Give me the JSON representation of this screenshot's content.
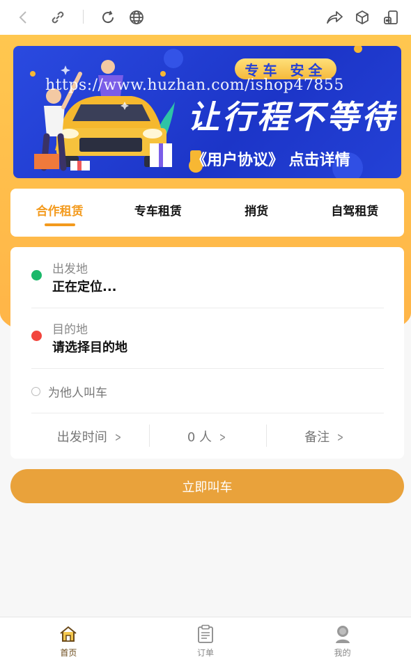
{
  "banner": {
    "watermark": "https://www.huzhan.com/ishop47855",
    "tag": "专车 安全",
    "title": "让行程不等待",
    "subtitle": "《用户协议》 点击详情"
  },
  "tabs": [
    {
      "label": "合作租赁",
      "active": true
    },
    {
      "label": "专车租赁",
      "active": false
    },
    {
      "label": "捎货",
      "active": false
    },
    {
      "label": "自驾租赁",
      "active": false
    }
  ],
  "form": {
    "origin_label": "出发地",
    "origin_value": "正在定位...",
    "destination_label": "目的地",
    "destination_value": "请选择目的地",
    "for_other_label": "为他人叫车",
    "time_label": "出发时间",
    "people_label": "0 人",
    "note_label": "备注"
  },
  "call_button": "立即叫车",
  "nav": [
    {
      "label": "首页",
      "icon": "home-icon",
      "active": true
    },
    {
      "label": "订单",
      "icon": "clipboard-icon",
      "active": false
    },
    {
      "label": "我的",
      "icon": "user-icon",
      "active": false
    }
  ],
  "colors": {
    "accent": "#f39a1d",
    "button": "#e9a23b",
    "origin_dot": "#1bb86a",
    "destination_dot": "#f2453d",
    "banner_blue": "#2441d6"
  }
}
